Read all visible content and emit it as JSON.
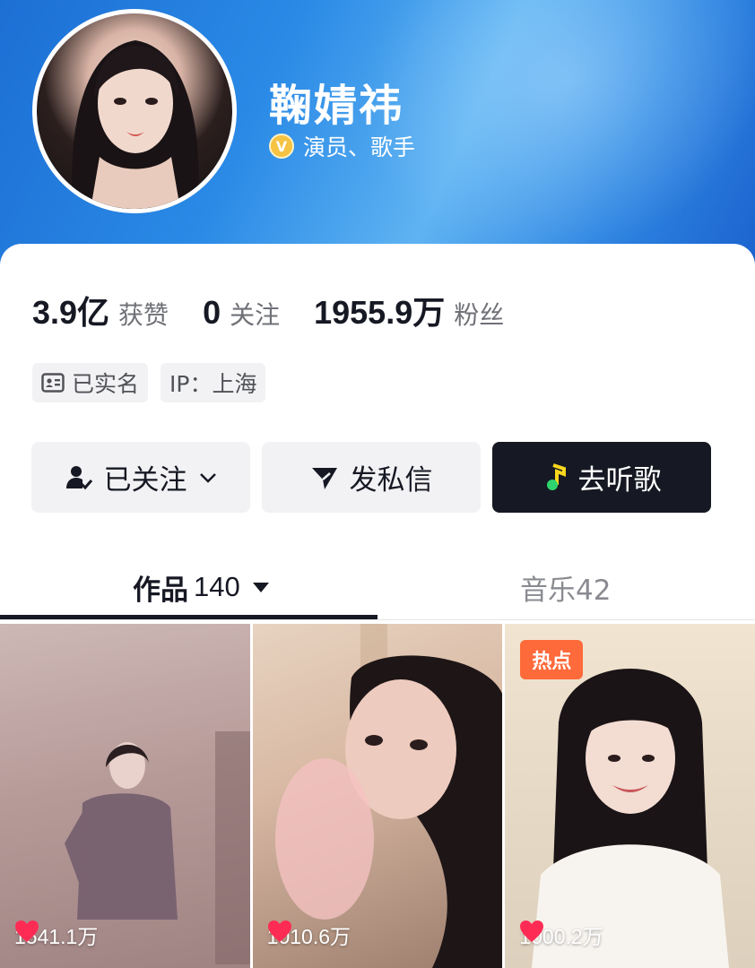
{
  "profile": {
    "name": "鞠婧祎",
    "verified_icon_label": "V",
    "verified_title": "演员、歌手"
  },
  "stats": [
    {
      "value": "3.9亿",
      "label": "获赞"
    },
    {
      "value": "0",
      "label": "关注"
    },
    {
      "value": "1955.9万",
      "label": "粉丝"
    }
  ],
  "chips": {
    "realname": "已实名",
    "ip": "IP：上海"
  },
  "buttons": {
    "following": "已关注",
    "message": "发私信",
    "listen": "去听歌"
  },
  "tabs": {
    "works_label": "作品",
    "works_count": "140",
    "music_label": "音乐42"
  },
  "videos": [
    {
      "likes": "1541.1万"
    },
    {
      "likes": "1010.6万"
    },
    {
      "likes": "1000.2万",
      "badge": "热点"
    }
  ],
  "colors": {
    "header_blue": "#2a8ae6",
    "dark_button": "#161823",
    "like_heart": "#fe2c55",
    "hot_badge": "#fe6a3a",
    "verify_gold": "#f5c242"
  },
  "icons": {
    "verify": "verified-v-icon",
    "realname": "id-card-icon",
    "following": "user-check-icon",
    "dropdown": "chevron-down-icon",
    "message": "send-icon",
    "listen": "music-note-icon",
    "tab_dropdown": "caret-down-icon",
    "like": "heart-icon"
  }
}
